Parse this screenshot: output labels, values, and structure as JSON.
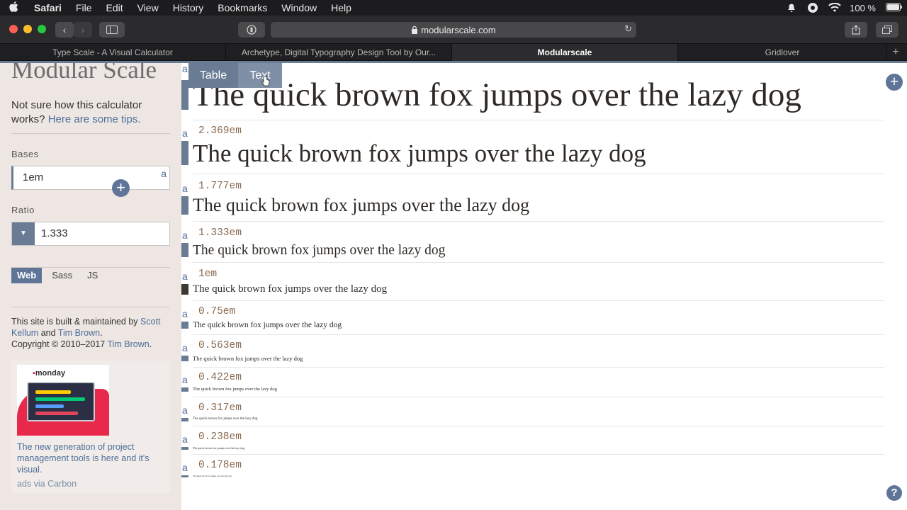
{
  "menubar": {
    "app": "Safari",
    "items": [
      "File",
      "Edit",
      "View",
      "History",
      "Bookmarks",
      "Window",
      "Help"
    ],
    "battery": "100 %"
  },
  "toolbar": {
    "url": "modularscale.com"
  },
  "tabs": [
    {
      "label": "Type Scale - A Visual Calculator"
    },
    {
      "label": "Archetype, Digital Typography Design Tool by Our..."
    },
    {
      "label": "Modularscale"
    },
    {
      "label": "Gridlover"
    }
  ],
  "sidebar": {
    "logo": "Modular Scale",
    "tips_text": "Not sure how this calculator works? ",
    "tips_link": "Here are some tips.",
    "bases_label": "Bases",
    "base_value": "1em",
    "base_marker": "a",
    "ratio_label": "Ratio",
    "ratio_value": "1.333",
    "langs": [
      "Web",
      "Sass",
      "JS"
    ],
    "credits_pre": "This site is built & maintained by ",
    "author1": "Scott Kellum",
    "credits_and": " and ",
    "author2": "Tim Brown",
    "credits_copy": "Copyright © 2010–2017 ",
    "ad_logo": "monday",
    "ad_text": "The new generation of project management tools is here and it's visual.",
    "ad_via": "ads via Carbon"
  },
  "main": {
    "view_tabs": [
      "Table",
      "Text"
    ],
    "sample_text": "The quick brown fox jumps over the lazy dog",
    "steps": [
      {
        "em": ""
      },
      {
        "em": "2.369em"
      },
      {
        "em": "1.777em"
      },
      {
        "em": "1.333em"
      },
      {
        "em": "1em"
      },
      {
        "em": "0.75em"
      },
      {
        "em": "0.563em"
      },
      {
        "em": "0.422em"
      },
      {
        "em": "0.317em"
      },
      {
        "em": "0.238em"
      },
      {
        "em": "0.178em"
      }
    ]
  },
  "colors": {
    "accent": "#6a7c93",
    "link": "#4c6f98",
    "sidebar_bg": "#ede6e2",
    "em_label": "#8a6a50"
  }
}
